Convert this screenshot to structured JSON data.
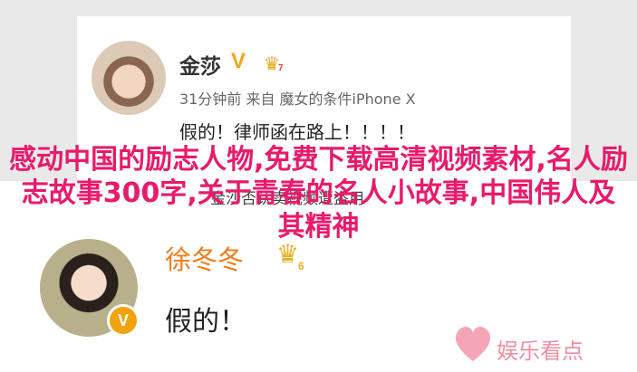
{
  "post1": {
    "username": "金莎",
    "verified_mark": "V",
    "level": "7",
    "meta": "31分钟前 来自 魔女的条件iPhone X",
    "content": "假的！律师函在路上！！！！"
  },
  "post2": {
    "username": "徐冬冬",
    "level": "6",
    "verified_mark": "V",
    "content": "假的！"
  },
  "overlay": {
    "headline": "感动中国的励志人物,免费下载高清视频素材,名人励志故事300字,关于青春的名人小故事,中国伟人及其精神",
    "subtitle": "金沙否认卖视频遭盗用"
  },
  "watermark": {
    "label": "娱乐看点"
  },
  "icons": [
    "crown-icon",
    "heart-logo-icon",
    "verified-icon"
  ],
  "colors": {
    "accent": "#e81a6c",
    "username2": "#f07c1a",
    "brand": "#f18ea2",
    "vip": "#f5a31d"
  }
}
